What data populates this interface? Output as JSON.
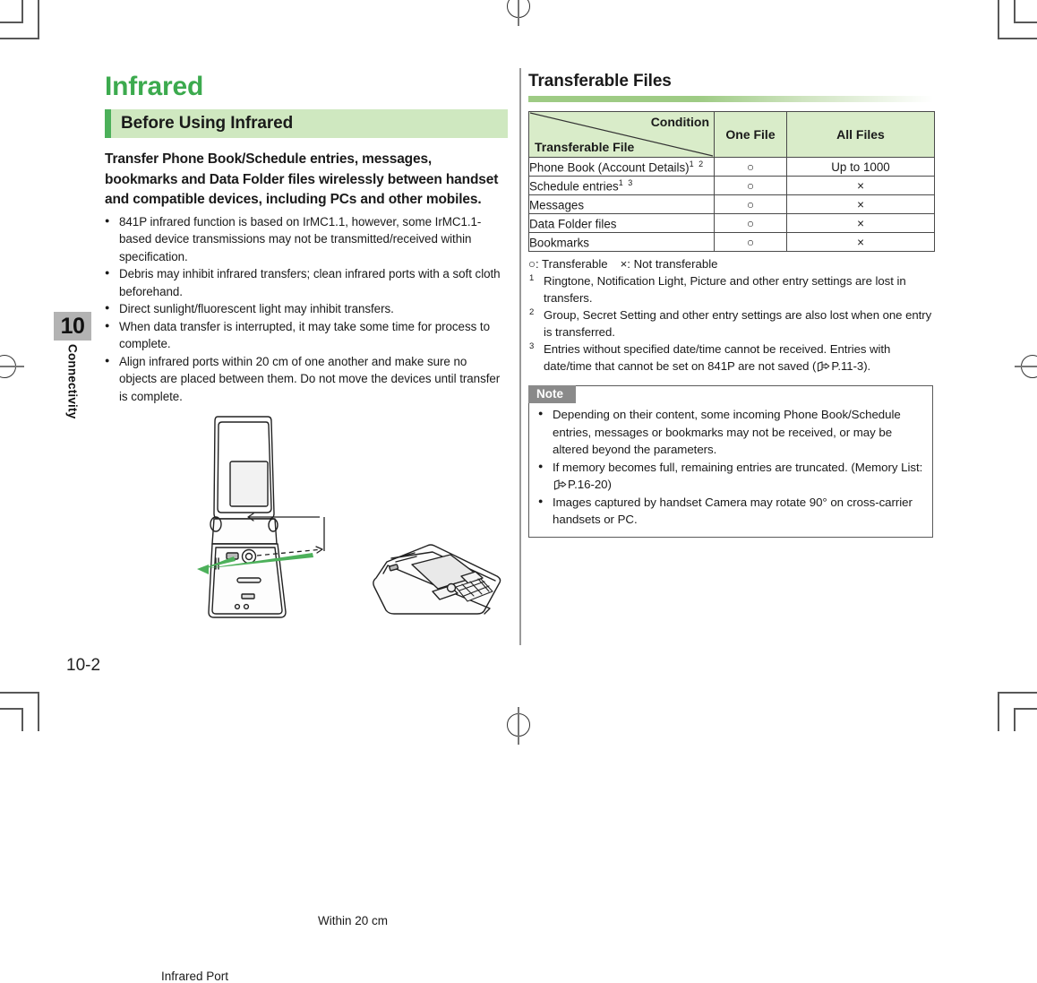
{
  "page": {
    "number": "10-2",
    "chapter_number": "10",
    "chapter_name": "Connectivity"
  },
  "left_column": {
    "title": "Infrared",
    "section_heading": "Before Using Infrared",
    "lead": "Transfer Phone Book/Schedule entries, messages, bookmarks and Data Folder files wirelessly between handset and compatible devices, including PCs and other mobiles.",
    "bullets": [
      "841P infrared function is based on IrMC1.1, however, some IrMC1.1-based device transmissions may not be transmitted/received within specification.",
      "Debris may inhibit infrared transfers; clean infrared ports with a soft cloth beforehand.",
      "Direct sunlight/fluorescent light may inhibit transfers.",
      "When data transfer is interrupted, it may take some time for process to complete.",
      "Align infrared ports within 20 cm of one another and make sure no objects are placed between them. Do not move the devices until transfer is complete."
    ],
    "figure": {
      "label_distance": "Within 20 cm",
      "label_port": "Infrared Port"
    }
  },
  "right_column": {
    "title": "Transferable Files",
    "table": {
      "corner_condition": "Condition",
      "corner_file": "Transferable File",
      "headers": [
        "One File",
        "All Files"
      ],
      "rows": [
        {
          "name": "Phone Book (Account Details)",
          "footnotes": "1 2",
          "one_file": "○",
          "all_files": "Up to 1000"
        },
        {
          "name": "Schedule entries",
          "footnotes": "1 3",
          "one_file": "○",
          "all_files": "×"
        },
        {
          "name": "Messages",
          "footnotes": "",
          "one_file": "○",
          "all_files": "×"
        },
        {
          "name": "Data Folder files",
          "footnotes": "",
          "one_file": "○",
          "all_files": "×"
        },
        {
          "name": "Bookmarks",
          "footnotes": "",
          "one_file": "○",
          "all_files": "×"
        }
      ]
    },
    "legend_transferable": "○: Transferable",
    "legend_not_transferable": "×: Not transferable",
    "footnotes": [
      {
        "num": "1",
        "text": "Ringtone, Notification Light, Picture and other entry settings are lost in transfers."
      },
      {
        "num": "2",
        "text": "Group, Secret Setting and other entry settings are also lost when one entry is transferred."
      },
      {
        "num": "3",
        "text": "Entries without specified date/time cannot be received. Entries with date/time that cannot be set on 841P are not saved (",
        "ref": "P.11-3",
        "text_after": ")."
      }
    ],
    "note": {
      "label": "Note",
      "items": [
        {
          "text": "Depending on their content, some incoming Phone Book/Schedule entries, messages or bookmarks may not be received, or may be altered beyond the parameters."
        },
        {
          "text": "If memory becomes full, remaining entries are truncated. (Memory List: ",
          "ref": "P.16-20",
          "text_after": ")"
        },
        {
          "text": "Images captured by handset Camera may rotate 90° on cross-carrier handsets or PC."
        }
      ]
    }
  },
  "colors": {
    "heading_green": "#3caa4e",
    "bar_green_light": "#cfe8c0",
    "bar_green_accent": "#4cb05a",
    "table_header_green": "#d9ecc9",
    "note_gray": "#8a8a8a",
    "tab_gray": "#b3b3b3"
  }
}
